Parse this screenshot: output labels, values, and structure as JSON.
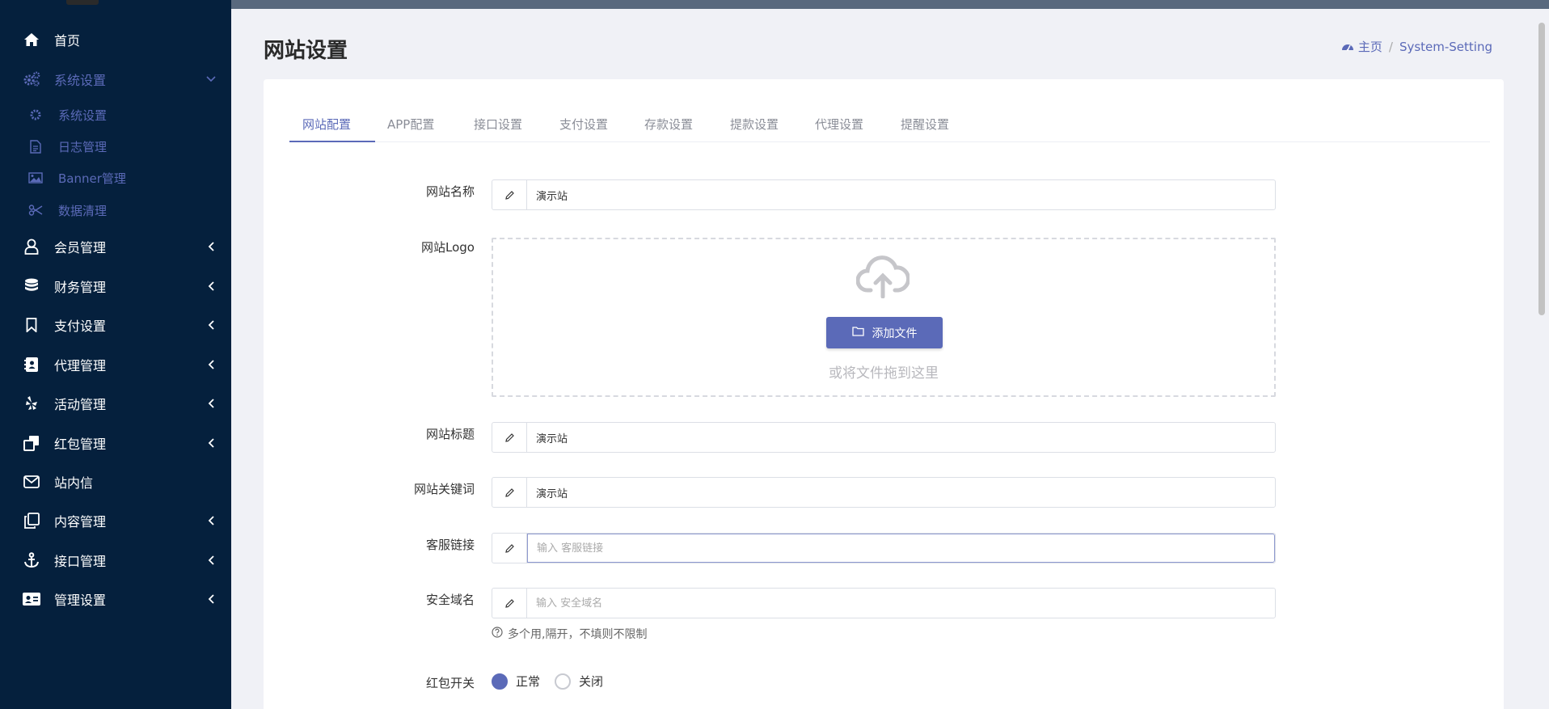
{
  "colors": {
    "sidebar_bg": "#05203d",
    "accent": "#5b6ab8",
    "page_bg": "#f0f1f6"
  },
  "sidebar": {
    "items": [
      {
        "label": "首页",
        "icon": "home-icon",
        "expandable": false
      },
      {
        "label": "系统设置",
        "icon": "cogs-icon",
        "expandable": true,
        "expanded": true
      },
      {
        "label": "会员管理",
        "icon": "user-icon",
        "expandable": true
      },
      {
        "label": "财务管理",
        "icon": "database-icon",
        "expandable": true
      },
      {
        "label": "支付设置",
        "icon": "bookmark-icon",
        "expandable": true
      },
      {
        "label": "代理管理",
        "icon": "contact-icon",
        "expandable": true
      },
      {
        "label": "活动管理",
        "icon": "yelp-icon",
        "expandable": true
      },
      {
        "label": "红包管理",
        "icon": "clone-icon",
        "expandable": true
      },
      {
        "label": "站内信",
        "icon": "envelope-icon",
        "expandable": false
      },
      {
        "label": "内容管理",
        "icon": "copy-icon",
        "expandable": true
      },
      {
        "label": "接口管理",
        "icon": "anchor-icon",
        "expandable": true
      },
      {
        "label": "管理设置",
        "icon": "id-card-icon",
        "expandable": true
      }
    ],
    "subitems": [
      {
        "label": "系统设置",
        "icon": "gear-icon"
      },
      {
        "label": "日志管理",
        "icon": "file-icon"
      },
      {
        "label": "Banner管理",
        "icon": "image-icon"
      },
      {
        "label": "数据清理",
        "icon": "scissors-icon"
      }
    ]
  },
  "header": {
    "title": "网站设置",
    "breadcrumb": {
      "home": "主页",
      "current": "System-Setting"
    }
  },
  "tabs": [
    "网站配置",
    "APP配置",
    "接口设置",
    "支付设置",
    "存款设置",
    "提款设置",
    "代理设置",
    "提醒设置"
  ],
  "form": {
    "site_name": {
      "label": "网站名称",
      "value": "演示站"
    },
    "site_logo": {
      "label": "网站Logo",
      "button": "添加文件",
      "hint": "或将文件拖到这里"
    },
    "site_title": {
      "label": "网站标题",
      "value": "演示站"
    },
    "site_keywords": {
      "label": "网站关键词",
      "value": "演示站"
    },
    "service_link": {
      "label": "客服链接",
      "placeholder": "输入 客服链接",
      "value": ""
    },
    "safe_domain": {
      "label": "安全域名",
      "placeholder": "输入 安全域名",
      "value": "",
      "help": "多个用,隔开，不填则不限制"
    },
    "red_packet": {
      "label": "红包开关",
      "options": [
        "正常",
        "关闭"
      ],
      "selected": "正常"
    }
  }
}
